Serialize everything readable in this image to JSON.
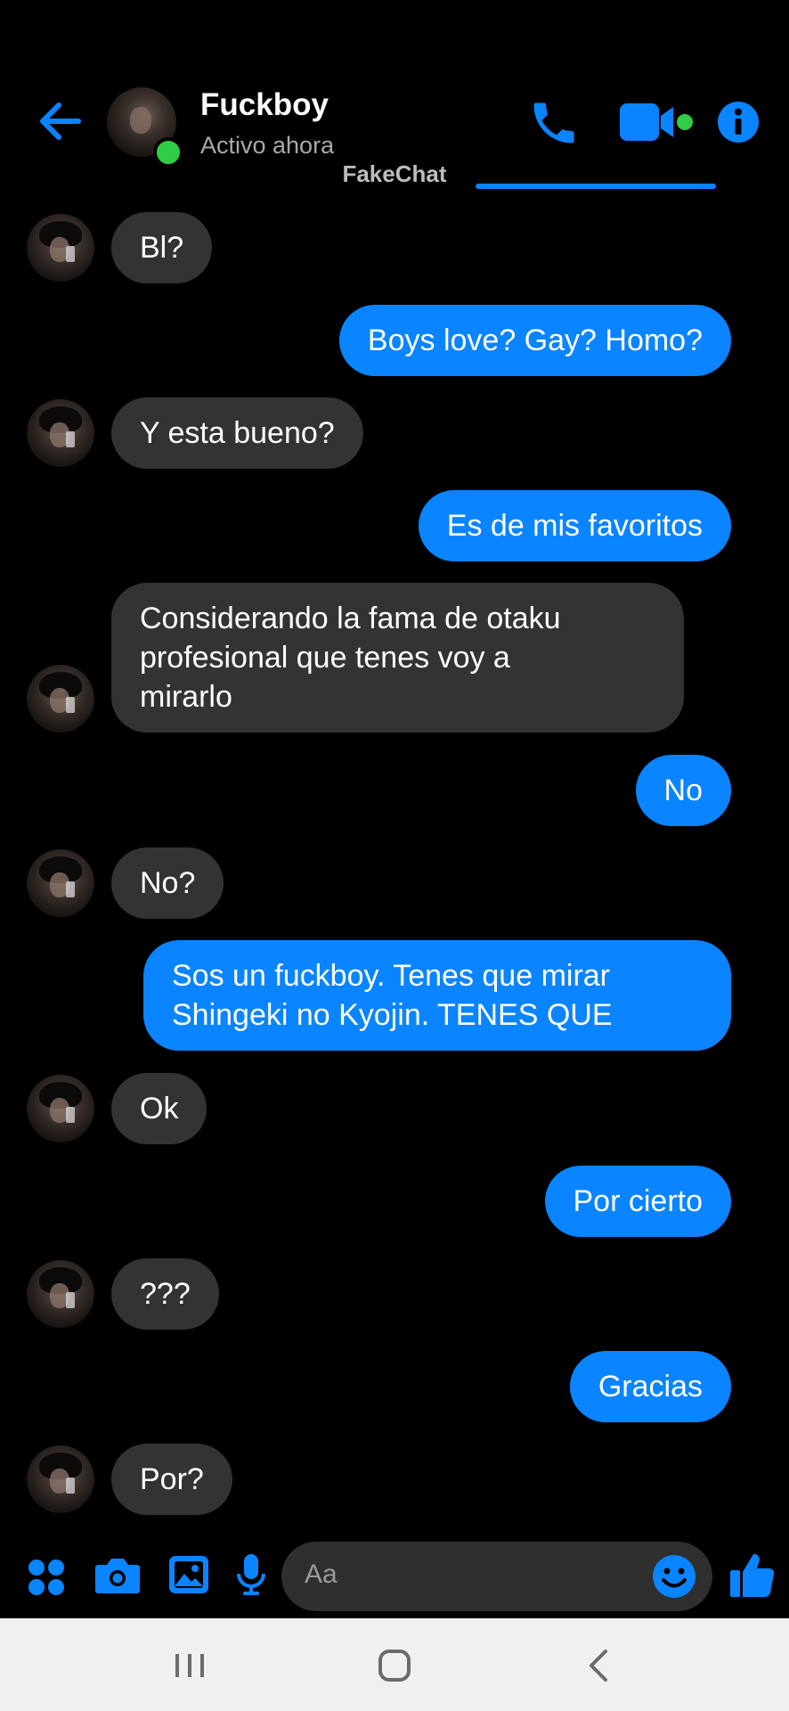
{
  "header": {
    "contact_name": "Fuckboy",
    "status": "Activo ahora",
    "watermark": "FakeChat",
    "online": true,
    "icons": {
      "back": "back-arrow-icon",
      "phone": "phone-icon",
      "video": "video-camera-icon",
      "info": "info-icon"
    }
  },
  "colors": {
    "accent": "#0a84ff",
    "incoming_bubble": "#333333",
    "background": "#000000",
    "online": "#31cc46"
  },
  "messages": [
    {
      "sender": "contact",
      "text": "Bl?"
    },
    {
      "sender": "me",
      "text": "Boys love? Gay? Homo?"
    },
    {
      "sender": "contact",
      "text": "Y esta bueno?"
    },
    {
      "sender": "me",
      "text": "Es de mis favoritos"
    },
    {
      "sender": "contact",
      "lines": [
        "Considerando la fama de otaku",
        "profesional que tenes voy a",
        "mirarlo"
      ]
    },
    {
      "sender": "me",
      "text": "No"
    },
    {
      "sender": "contact",
      "text": "No?"
    },
    {
      "sender": "me",
      "lines": [
        "Sos un fuckboy. Tenes que mirar",
        "Shingeki no Kyojin. TENES QUE"
      ]
    },
    {
      "sender": "contact",
      "text": "Ok"
    },
    {
      "sender": "me",
      "text": "Por cierto"
    },
    {
      "sender": "contact",
      "text": "???"
    },
    {
      "sender": "me",
      "text": "Gracias"
    },
    {
      "sender": "contact",
      "text": "Por?"
    }
  ],
  "composer": {
    "placeholder": "Aa",
    "icons": [
      "apps-grid-icon",
      "camera-icon",
      "gallery-icon",
      "microphone-icon",
      "emoji-icon",
      "thumbs-up-icon"
    ]
  },
  "system_nav": {
    "icons": [
      "recent-apps-icon",
      "home-icon",
      "back-icon"
    ]
  }
}
